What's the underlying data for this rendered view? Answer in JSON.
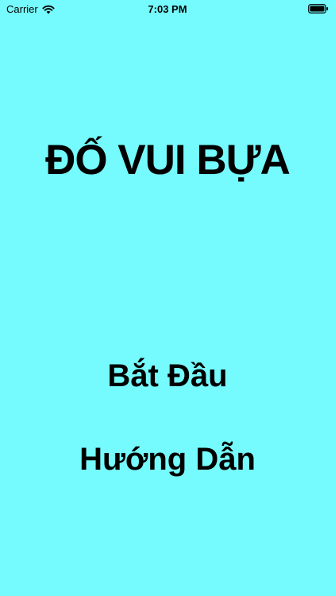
{
  "colors": {
    "background": "#75fbfd",
    "text": "#000000"
  },
  "status_bar": {
    "carrier": "Carrier",
    "time": "7:03 PM",
    "icons": [
      "wifi-icon",
      "battery-icon"
    ]
  },
  "main": {
    "title": "ĐỐ VUI BỰA",
    "start_label": "Bắt Đầu",
    "guide_label": "Hướng Dẫn"
  }
}
